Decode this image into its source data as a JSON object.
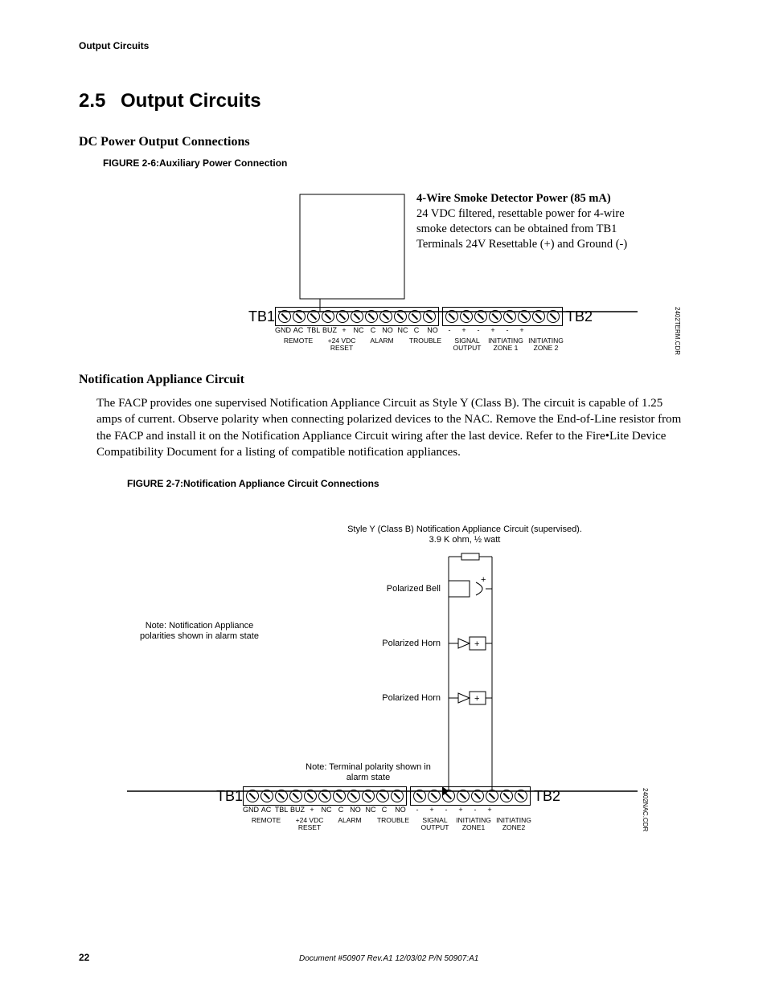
{
  "header": "Output Circuits",
  "section": {
    "number": "2.5",
    "title": "Output Circuits"
  },
  "dc_heading": "DC Power Output Connections",
  "figure26": {
    "prefix": "FIGURE 2-6:",
    "title": "Auxiliary Power Connection"
  },
  "detector": {
    "title": "4-Wire Smoke Detector Power (85 mA)",
    "line1": "24 VDC filtered, resettable power for 4-wire",
    "line2": "smoke detectors can be obtained from TB1",
    "line3": "Terminals 24V Resettable (+) and Ground (-)"
  },
  "tb": {
    "left": "TB1",
    "right": "TB2",
    "pins1": [
      "GND",
      "AC",
      "TBL",
      "BUZ",
      "+",
      "NC",
      "C",
      "NO",
      "NC",
      "C",
      "NO",
      "-",
      "+",
      "-",
      "+",
      "-",
      "+"
    ],
    "groups": [
      "REMOTE",
      "+24 VDC\nRESET",
      "ALARM",
      "TROUBLE",
      "SIGNAL\nOUTPUT",
      "INITIATING\nZONE 1",
      "INITIATING\nZONE 2"
    ],
    "groups2": [
      "REMOTE",
      "+24 VDC\nRESET",
      "ALARM",
      "TROUBLE",
      "SIGNAL\nOUTPUT",
      "INITIATING\nZONE1",
      "INITIATING\nZONE2"
    ]
  },
  "sidecode1": "2402TERM.CDR",
  "sidecode2": "2402NAC.CDR",
  "nac_heading": "Notification Appliance Circuit",
  "nac_body": "The FACP provides one supervised Notification Appliance Circuit as Style Y (Class B).  The circuit is capable of 1.25 amps of current.  Observe polarity when connecting polarized devices to the NAC.  Remove the End-of-Line resistor from the FACP and install it on the Notification Appliance Circuit wiring after the last device.  Refer to the Fire•Lite Device Compatibility Document for a listing of compatible notification appliances.",
  "figure27": {
    "prefix": "FIGURE 2-7:",
    "title": "Notification Appliance Circuit Connections"
  },
  "fig27": {
    "caption_top1": "Style Y (Class B) Notification Appliance Circuit (supervised).",
    "caption_top2": "3.9 K ohm, ½ watt",
    "note_polarity1": "Note: Notification Appliance",
    "note_polarity2": "polarities shown in alarm state",
    "bell": "Polarized Bell",
    "horn1": "Polarized Horn",
    "horn2": "Polarized Horn",
    "term_note1": "Note: Terminal polarity shown in",
    "term_note2": "alarm state"
  },
  "footer": {
    "page": "22",
    "docinfo": "Document #50907   Rev.A1   12/03/02   P/N 50907:A1"
  }
}
